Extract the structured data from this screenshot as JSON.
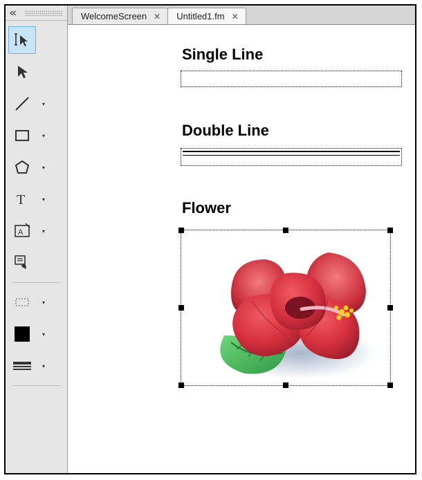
{
  "tabs": [
    {
      "label": "WelcomeScreen",
      "active": false
    },
    {
      "label": "Untitled1.fm",
      "active": true
    }
  ],
  "canvas": {
    "heading_single": "Single Line",
    "heading_double": "Double Line",
    "heading_flower": "Flower"
  },
  "tools": {
    "smart_select": "smart-select-tool",
    "select": "select-tool",
    "line": "line-tool",
    "rectangle": "rectangle-tool",
    "polygon": "polygon-tool",
    "text": "text-tool",
    "text_frame": "text-frame-tool",
    "hotspot": "hotspot-tool",
    "marquee": "marquee-tool",
    "fill": "fill-swatch",
    "line_style": "line-style-swatch"
  }
}
